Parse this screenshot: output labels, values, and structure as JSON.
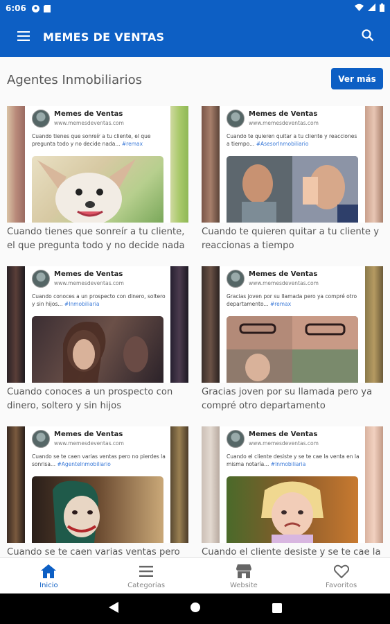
{
  "status": {
    "time": "6:06"
  },
  "app_bar": {
    "title": "MEMES DE VENTAS",
    "menu_icon": "menu-icon",
    "search_icon": "search-icon"
  },
  "section": {
    "title": "Agentes Inmobiliarios",
    "see_more": "Ver más"
  },
  "post_common": {
    "author": "Memes de Ventas",
    "url": "www.memesdeventas.com"
  },
  "cards": [
    {
      "post_text": "Cuando tienes que sonreír a tu cliente, el que pregunta todo y no decide nada...",
      "hashtag": "#remax",
      "caption": "Cuando tienes que sonreír a tu cliente, el que pregunta todo y no decide nada"
    },
    {
      "post_text": "Cuando te quieren quitar a tu cliente y reacciones a tiempo...",
      "hashtag": "#AsesorInmobiliario",
      "caption": "Cuando te quieren quitar a tu cliente y reaccionas a tiempo"
    },
    {
      "post_text": "Cuando conoces a un prospecto con dinero, soltero y sin hijos...",
      "hashtag": "#Inmobiliaria",
      "caption": "Cuando conoces a un prospecto con dinero, soltero y sin hijos"
    },
    {
      "post_text": "Gracias joven por su llamada pero ya compré otro departamento...",
      "hashtag": "#remax",
      "caption": "Gracias joven por su llamada pero ya compré otro departamento"
    },
    {
      "post_text": "Cuando se te caen varias ventas pero no pierdes la sonrisa...",
      "hashtag": "#AgenteInmobiliario",
      "caption": "Cuando se te caen varias ventas pero no"
    },
    {
      "post_text": "Cuando el cliente desiste y se te cae la venta en la misma notaría...",
      "hashtag": "#Inmobiliaria",
      "caption": "Cuando el cliente desiste y se te cae la"
    }
  ],
  "bottom_nav": [
    {
      "label": "Inicio",
      "icon": "home-icon"
    },
    {
      "label": "Categorías",
      "icon": "list-icon"
    },
    {
      "label": "Website",
      "icon": "store-icon"
    },
    {
      "label": "Favoritos",
      "icon": "heart-icon"
    }
  ],
  "colors": {
    "primary": "#0d5fc4",
    "hashtag": "#3b7ad8"
  }
}
